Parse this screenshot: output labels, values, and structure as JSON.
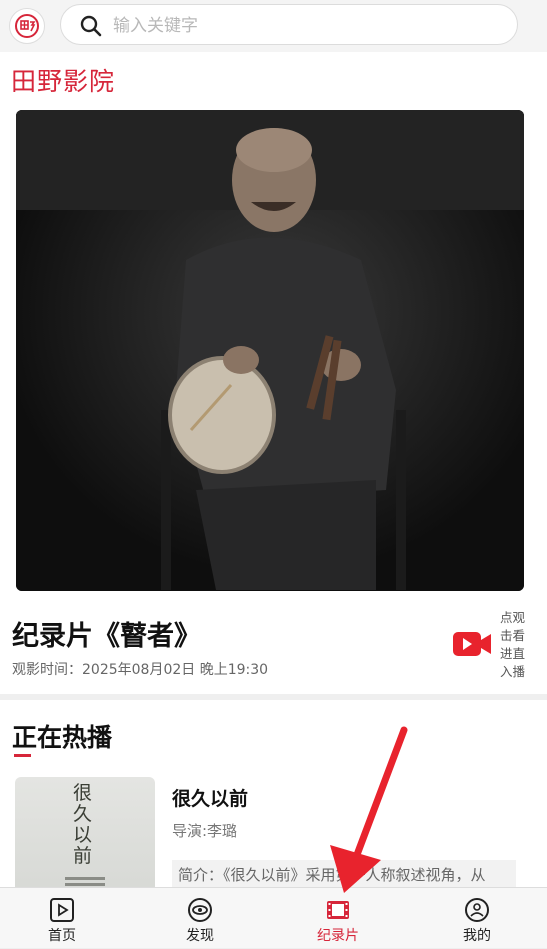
{
  "search": {
    "placeholder": "输入关键字"
  },
  "brand": {
    "name": "田野影院"
  },
  "featured": {
    "title": "纪录片《瞽者》",
    "screening_time": "观影时间：2025年08月02日 晚上19:30",
    "watch_live_label": "点观击看进直入播"
  },
  "now_playing": {
    "section_title": "正在热播",
    "items": [
      {
        "title": "很久以前",
        "director": "导演:李璐",
        "intro": "简介：《很久以前》采用第一人称叙述视角，从"
      }
    ]
  },
  "poster_text": "很久以前",
  "nav": {
    "items": [
      {
        "label": "首页",
        "icon": "play-square-icon",
        "active": false
      },
      {
        "label": "发现",
        "icon": "eye-circle-icon",
        "active": false
      },
      {
        "label": "纪录片",
        "icon": "film-icon",
        "active": true
      },
      {
        "label": "我的",
        "icon": "user-circle-icon",
        "active": false
      }
    ]
  },
  "colors": {
    "accent": "#d6263a",
    "annotation_arrow": "#e8232d"
  }
}
